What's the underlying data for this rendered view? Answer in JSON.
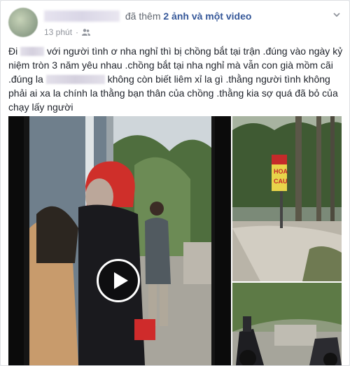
{
  "header": {
    "added_text": "đã thêm",
    "added_strong": "2 ảnh và một video",
    "time": "13 phút",
    "dot": "·"
  },
  "post": {
    "line1a": "Đi",
    "line1b": "với người tình ơ nha nghỉ thì bị chồng bắt tại trận .đúng vào ngày kỷ",
    "line2": "niệm tròn 3 năm yêu nhau .chồng bắt tại nha nghỉ mà vẫn con già mồm cãi",
    "line3a": ".đúng la",
    "line3b": "không còn biết liêm xỉ la gì .thằng người tình không",
    "line4": "phải ai xa la chính la thằng bạn thân của chồng .thằng kia sợ quá đã bỏ của",
    "line5": "chạy lấy người"
  },
  "sign": {
    "text1": "HOA",
    "text2": "CAU"
  },
  "colors": {
    "link": "#365899",
    "text": "#1d2129",
    "meta": "#90949c"
  },
  "icons": [
    "friends-icon",
    "chevron-down-icon",
    "play-icon"
  ]
}
